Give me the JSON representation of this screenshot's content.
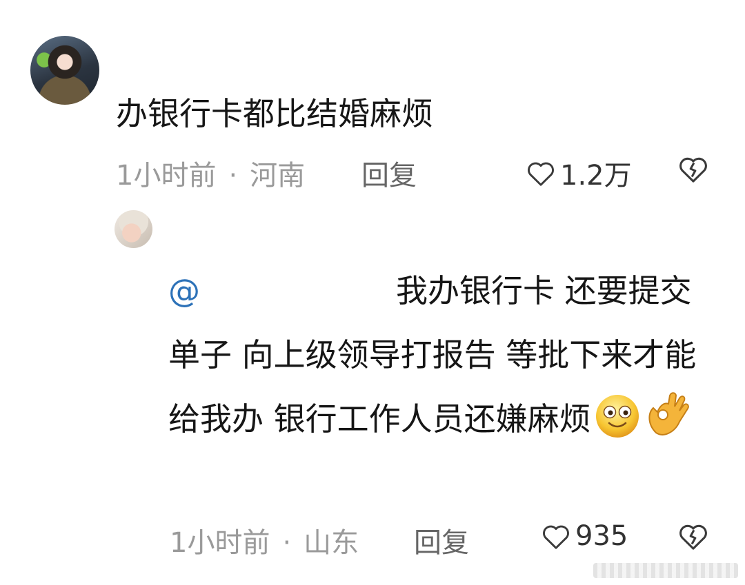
{
  "comments": [
    {
      "text": "办银行卡都比结婚麻烦",
      "time": "1小时前",
      "separator": "·",
      "location": "河南",
      "reply_label": "回复",
      "likes": "1.2万"
    }
  ],
  "reply": {
    "mention": "@",
    "text_first_line": "我办银行卡 还要提",
    "text_rest": "交单子 向上级领导打报告 等批下来才能给我办 银行工作人员还嫌麻烦",
    "emojis": [
      "smirk-face-emoji",
      "ok-hand-emoji"
    ],
    "time": "1小时前",
    "separator": "·",
    "location": "山东",
    "reply_label": "回复",
    "likes": "935"
  },
  "colors": {
    "mention": "#2d72b8",
    "meta": "#9a9a9a",
    "text": "#161616"
  }
}
